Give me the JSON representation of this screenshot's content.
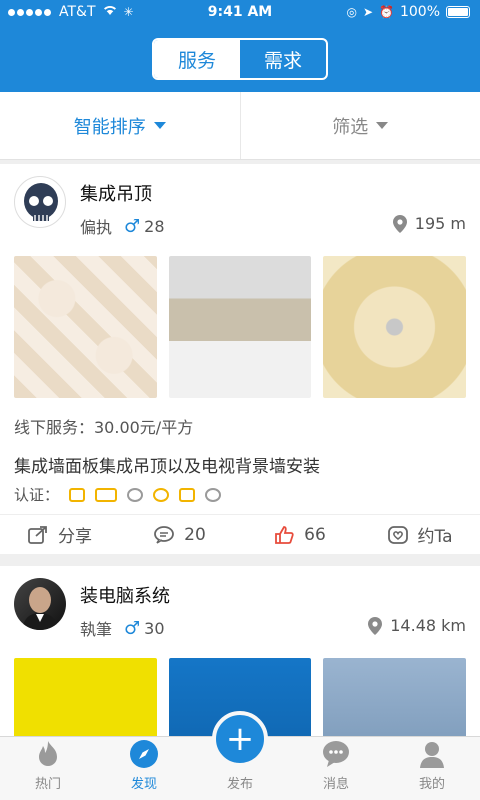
{
  "status_bar": {
    "carrier": "AT&T",
    "time": "9:41 AM",
    "battery": "100%"
  },
  "segment": {
    "left": "服务",
    "right": "需求"
  },
  "sortbar": {
    "sort": "智能排序",
    "filter": "筛选"
  },
  "cards": [
    {
      "title": "集成吊顶",
      "user": "偏执",
      "age": "28",
      "distance": "195 m",
      "price": "线下服务：30.00元/平方",
      "desc": "集成墙面板集成吊顶以及电视背景墙安装",
      "cert_label": "认证：",
      "share": "分享",
      "comments": "20",
      "likes": "66",
      "date": "约Ta"
    },
    {
      "title": "装电脑系统",
      "user": "執筆",
      "age": "30",
      "distance": "14.48 km"
    }
  ],
  "tabs": [
    {
      "label": "热门"
    },
    {
      "label": "发现"
    },
    {
      "label": "发布"
    },
    {
      "label": "消息"
    },
    {
      "label": "我的"
    }
  ],
  "colors": {
    "brand": "#1e88d9",
    "like": "#e74c3c",
    "badge": "#f2b400"
  },
  "icons": [
    "signal-dots",
    "wifi-icon",
    "location-arrow",
    "alarm-icon",
    "battery-icon",
    "map-pin-icon",
    "share-icon",
    "comment-icon",
    "like-icon",
    "heart-message-icon",
    "fire-icon",
    "compass-icon",
    "plus-icon",
    "chat-icon",
    "person-icon"
  ]
}
